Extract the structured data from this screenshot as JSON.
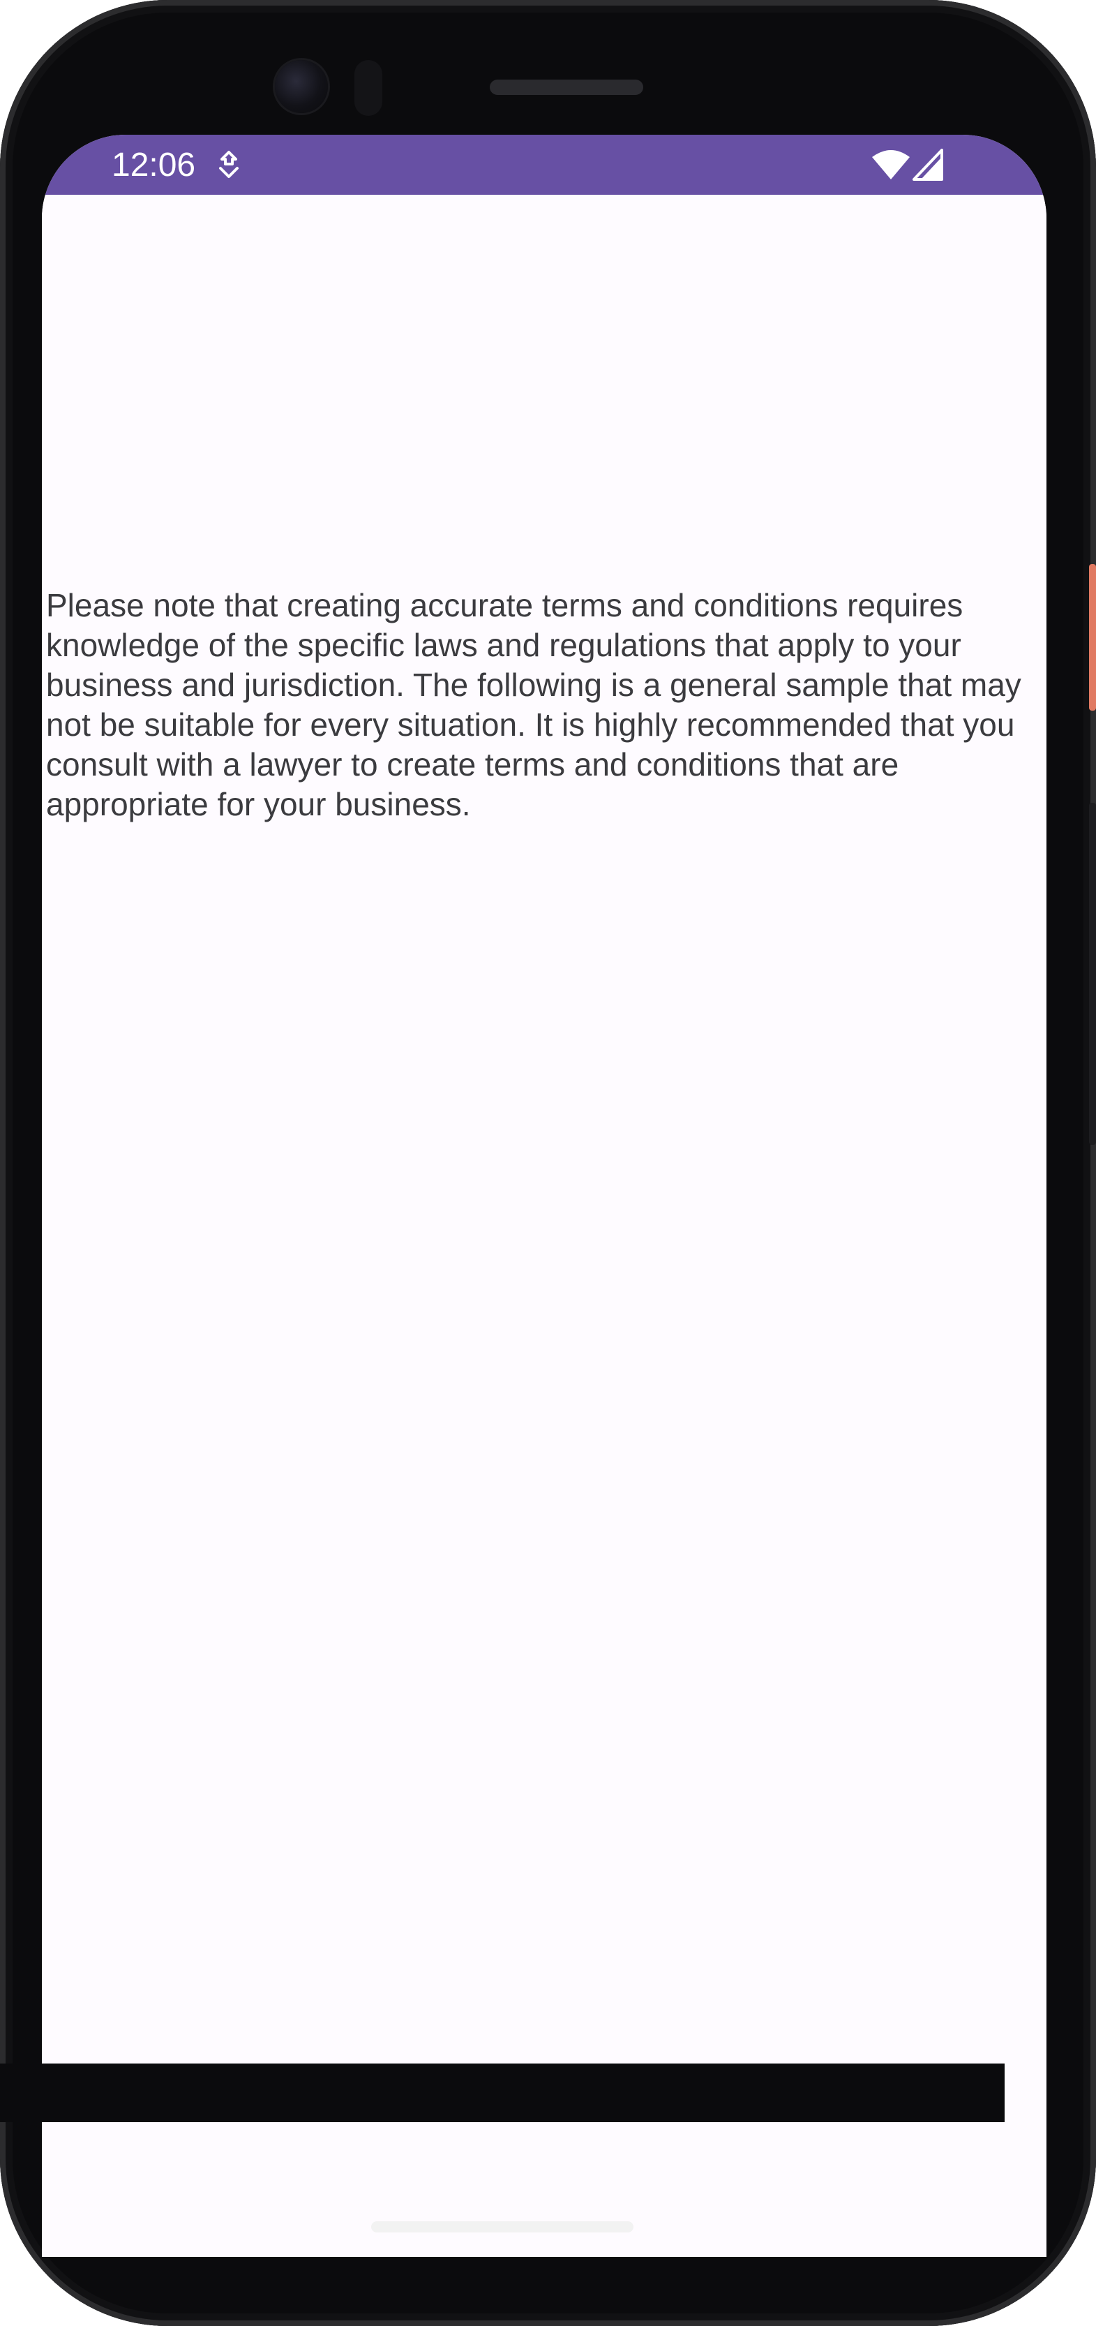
{
  "status_bar": {
    "time": "12:06",
    "background_color": "#6750a4",
    "icons": [
      "download-notification-icon",
      "wifi-icon",
      "cell-signal-icon"
    ]
  },
  "content": {
    "body_text": "Please note that creating accurate terms and conditions requires knowledge of the specific laws and regulations that apply to your business and jurisdiction. The following is a general sample that may not be suitable for every situation. It is highly recommended that you consult with a lawyer to create terms and conditions that are appropriate for your business.",
    "background_color": "#fefbff",
    "text_color": "#3b3b3f"
  },
  "navigation": {
    "gesture_handle": "home-gesture-handle"
  }
}
